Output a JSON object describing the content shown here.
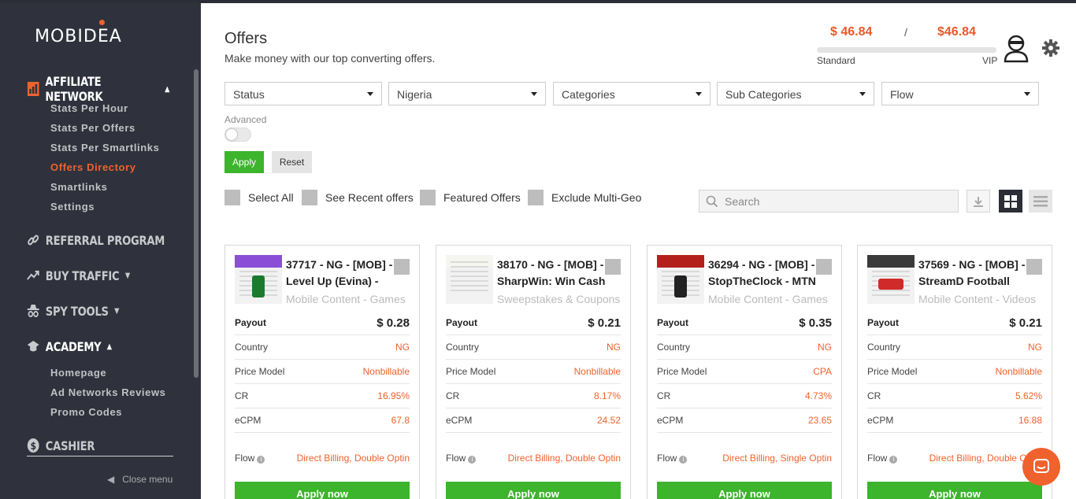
{
  "brand": {
    "logo_text": "MOBIDEA",
    "accent": "#f0622d",
    "sidebar_bg": "#2f323c",
    "green": "#3cb42c"
  },
  "sidebar": {
    "affiliate": "AFFILIATE NETWORK",
    "affiliate_items": [
      "Stats Per Hour",
      "Stats Per Offers",
      "Stats Per Smartlinks",
      "Offers Directory",
      "Smartlinks",
      "Settings"
    ],
    "referral": "REFERRAL PROGRAM",
    "buy_traffic": "BUY TRAFFIC",
    "spy_tools": "SPY TOOLS",
    "academy": "ACADEMY",
    "academy_items": [
      "Homepage",
      "Ad Networks Reviews",
      "Promo Codes"
    ],
    "cashier": "CASHIER",
    "close_menu": "Close menu"
  },
  "header": {
    "title": "Offers",
    "subtitle": "Make money with our top converting offers.",
    "balance_left": "$ 46.84",
    "balance_sep": "/",
    "balance_right": "$46.84",
    "level_left": "Standard",
    "level_right": "VIP"
  },
  "filters": {
    "status": "Status",
    "country": "Nigeria",
    "categories": "Categories",
    "sub_categories": "Sub Categories",
    "flow": "Flow",
    "advanced": "Advanced",
    "apply": "Apply",
    "reset": "Reset"
  },
  "checks": {
    "select_all": "Select All",
    "recent": "See Recent offers",
    "featured": "Featured Offers",
    "exclude": "Exclude Multi-Geo"
  },
  "search": {
    "placeholder": "Search"
  },
  "labels": {
    "payout": "Payout",
    "country": "Country",
    "price_model": "Price Model",
    "cr": "CR",
    "ecpm": "eCPM",
    "flow": "Flow",
    "apply_now": "Apply now"
  },
  "offers": [
    {
      "title": "37717 - NG - [MOB] - Level Up (Evina) -",
      "category": "Mobile Content - Games",
      "payout": "$ 0.28",
      "country": "NG",
      "price_model": "Nonbillable",
      "cr": "16.95%",
      "ecpm": "67.8",
      "flow": "Direct Billing, Double Optin"
    },
    {
      "title": "38170 - NG - [MOB] - SharpWin: Win Cash",
      "category": "Sweepstakes & Coupons",
      "payout": "$ 0.21",
      "country": "NG",
      "price_model": "Nonbillable",
      "cr": "8.17%",
      "ecpm": "24.52",
      "flow": "Direct Billing, Double Optin"
    },
    {
      "title": "36294 - NG - [MOB] - StopTheClock - MTN",
      "category": "Mobile Content - Games",
      "payout": "$ 0.35",
      "country": "NG",
      "price_model": "CPA",
      "cr": "4.73%",
      "ecpm": "23.65",
      "flow": "Direct Billing, Single Optin"
    },
    {
      "title": "37569 - NG - [MOB] - StreamD Football",
      "category": "Mobile Content - Videos",
      "payout": "$ 0.21",
      "country": "NG",
      "price_model": "Nonbillable",
      "cr": "5.62%",
      "ecpm": "16.88",
      "flow": "Direct Billing, Double Optin"
    }
  ]
}
